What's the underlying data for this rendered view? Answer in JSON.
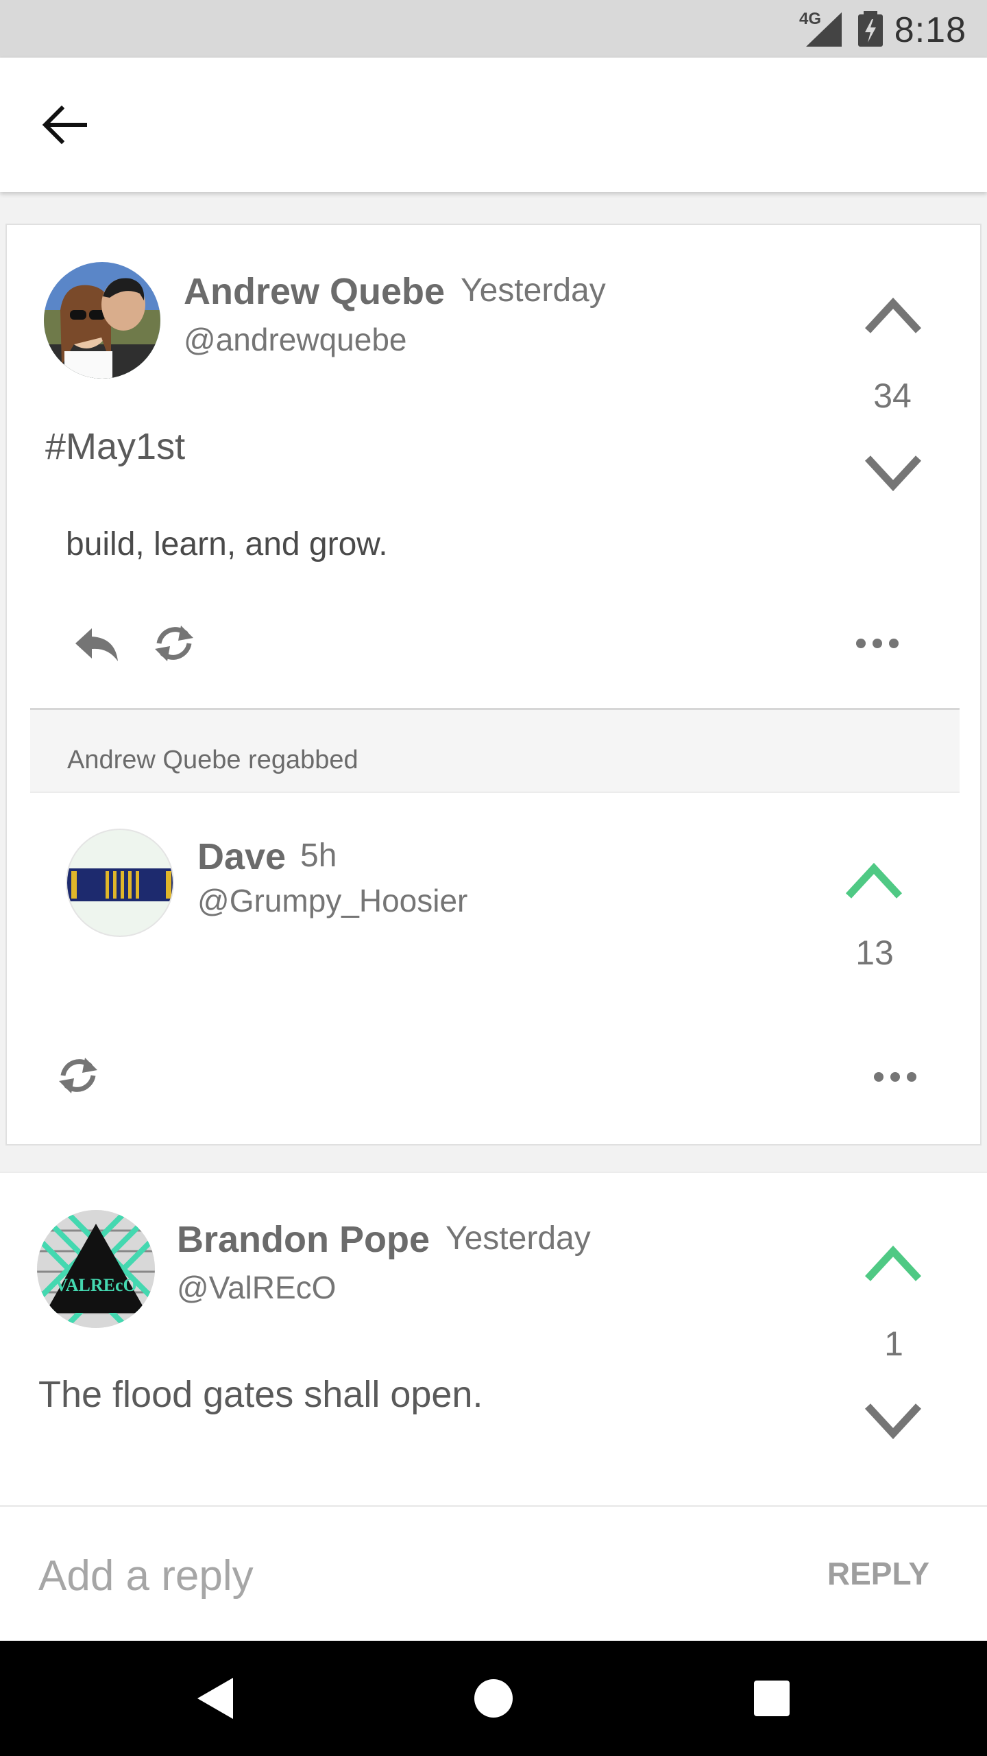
{
  "status_bar": {
    "time": "8:18",
    "network": "4G"
  },
  "main_post": {
    "name": "Andrew Quebe",
    "time": "Yesterday",
    "handle": "@andrewquebe",
    "text": "#May1st",
    "score": "34",
    "quoted_text": "build, learn, and grow."
  },
  "regab": {
    "label": "Andrew Quebe regabbed",
    "name": "Dave",
    "time": "5h",
    "handle": "@Grumpy_Hoosier",
    "score": "13"
  },
  "reply_post": {
    "name": "Brandon Pope",
    "time": "Yesterday",
    "handle": "@ValREcO",
    "text": "The flood gates shall open.",
    "score": "1",
    "avatar_text": "VALREcO"
  },
  "reply_bar": {
    "placeholder": "Add a reply",
    "button": "REPLY"
  },
  "colors": {
    "upvote_active": "#4fc984",
    "icon_grey": "#757575"
  }
}
